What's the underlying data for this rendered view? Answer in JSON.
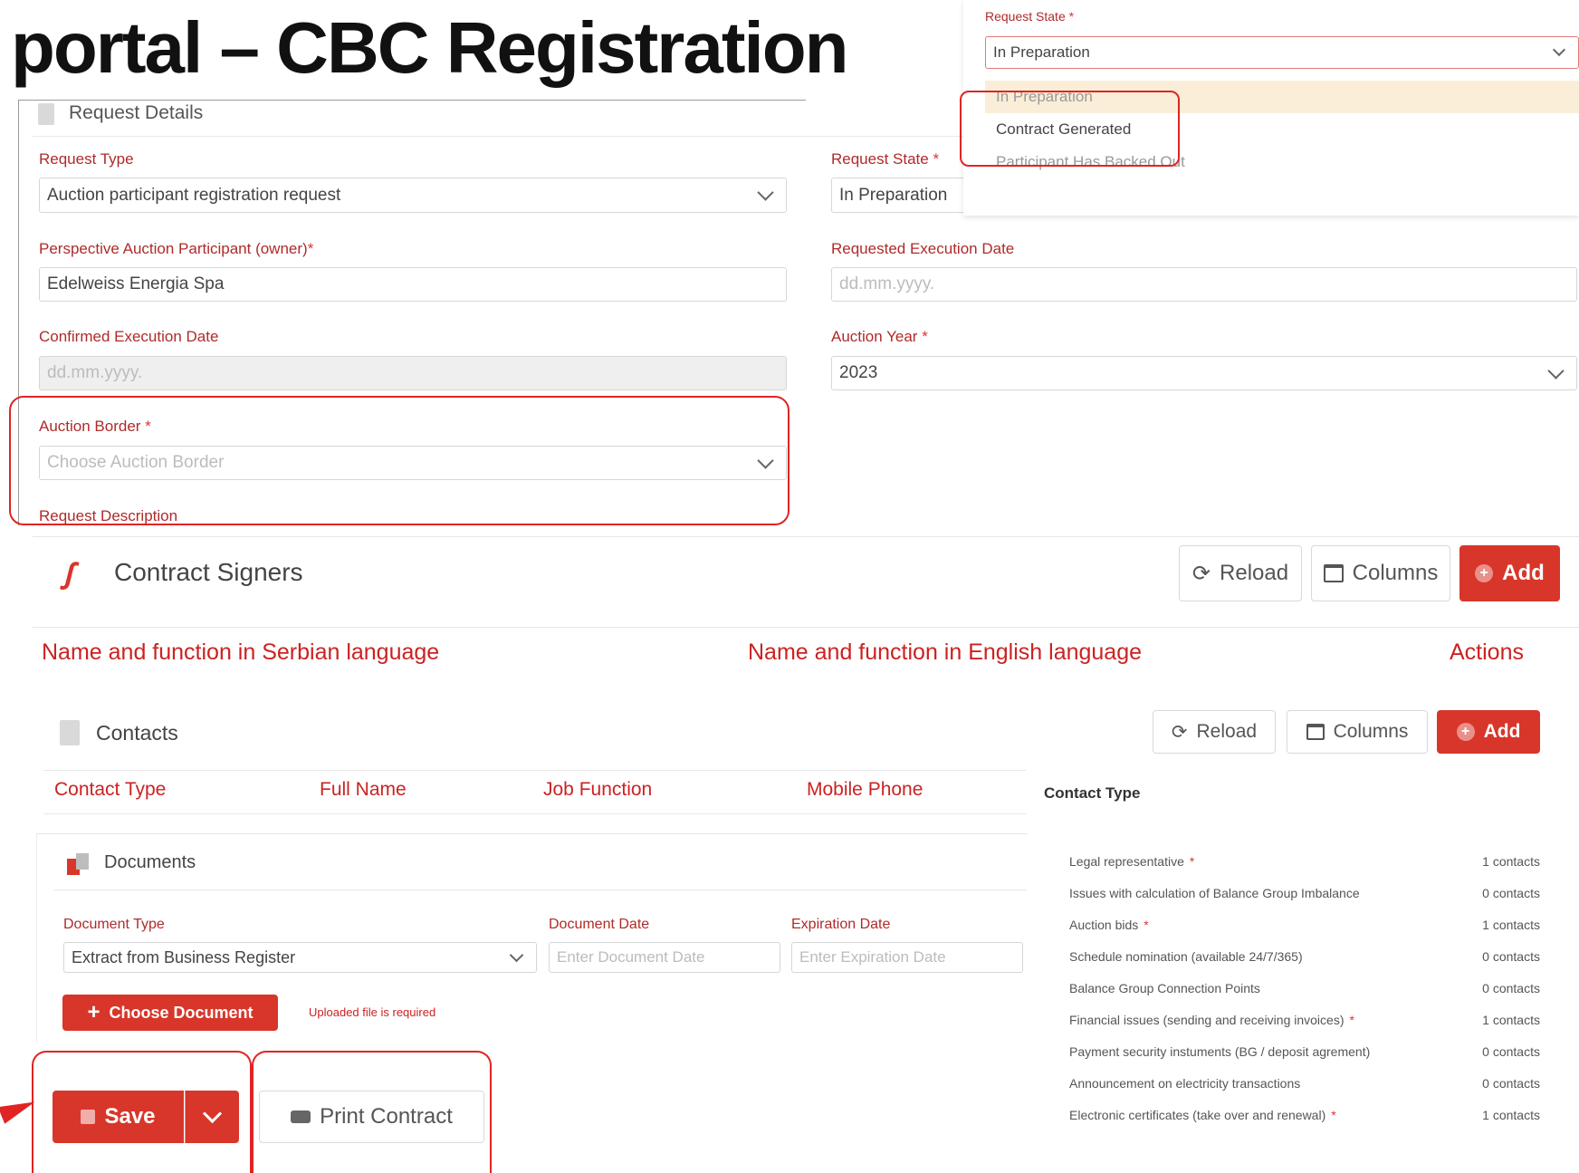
{
  "title": "portal – CBC Registration",
  "request_details": {
    "section_title": "Request Details",
    "request_type_label": "Request Type",
    "request_type_value": "Auction participant registration request",
    "request_state_label": "Request State",
    "request_state_value": "In Preparation",
    "owner_label": "Perspective Auction Participant (owner)",
    "owner_value": "Edelweiss Energia Spa",
    "requested_exec_label": "Requested Execution Date",
    "requested_exec_placeholder": "dd.mm.yyyy.",
    "confirmed_exec_label": "Confirmed Execution Date",
    "confirmed_exec_placeholder": "dd.mm.yyyy.",
    "auction_year_label": "Auction Year",
    "auction_year_value": "2023",
    "auction_border_label": "Auction Border",
    "auction_border_placeholder": "Choose Auction Border",
    "request_description_label": "Request Description",
    "required_mark": "*"
  },
  "state_dropdown": {
    "label": "Request State",
    "selected": "In Preparation",
    "options": [
      "In Preparation",
      "Contract Generated",
      "Participant Has Backed Out"
    ]
  },
  "contract_signers": {
    "title": "Contract Signers",
    "reload": "Reload",
    "columns": "Columns",
    "add": "Add",
    "headers": [
      "Name and function in Serbian language",
      "Name and function in English language",
      "Actions"
    ]
  },
  "contacts": {
    "title": "Contacts",
    "reload": "Reload",
    "columns": "Columns",
    "add": "Add",
    "headers": [
      "Contact Type",
      "Full Name",
      "Job Function",
      "Mobile Phone"
    ]
  },
  "contact_types": {
    "title": "Contact Type",
    "rows": [
      {
        "name": "Legal representative",
        "required": true,
        "count": "1 contacts"
      },
      {
        "name": "Issues with calculation of Balance Group Imbalance",
        "required": false,
        "count": "0 contacts"
      },
      {
        "name": "Auction bids",
        "required": true,
        "count": "1 contacts"
      },
      {
        "name": "Schedule nomination (available 24/7/365)",
        "required": false,
        "count": "0 contacts"
      },
      {
        "name": "Balance Group Connection Points",
        "required": false,
        "count": "0 contacts"
      },
      {
        "name": "Financial issues (sending and receiving invoices)",
        "required": true,
        "count": "1 contacts"
      },
      {
        "name": "Payment security instuments (BG / deposit agrement)",
        "required": false,
        "count": "0 contacts"
      },
      {
        "name": "Announcement on electricity transactions",
        "required": false,
        "count": "0 contacts"
      },
      {
        "name": "Electronic certificates (take over and renewal)",
        "required": true,
        "count": "1 contacts"
      }
    ]
  },
  "documents": {
    "title": "Documents",
    "doc_type_label": "Document Type",
    "doc_type_value": "Extract from Business Register",
    "doc_date_label": "Document Date",
    "doc_date_placeholder": "Enter Document Date",
    "exp_date_label": "Expiration Date",
    "exp_date_placeholder": "Enter Expiration Date",
    "choose_button": "Choose Document",
    "error_text": "Uploaded file is required"
  },
  "actions": {
    "save": "Save",
    "print": "Print Contract"
  },
  "colors": {
    "accent_red": "#d8362a",
    "label_red": "#b02a2a",
    "highlight_box": "#e02424"
  }
}
